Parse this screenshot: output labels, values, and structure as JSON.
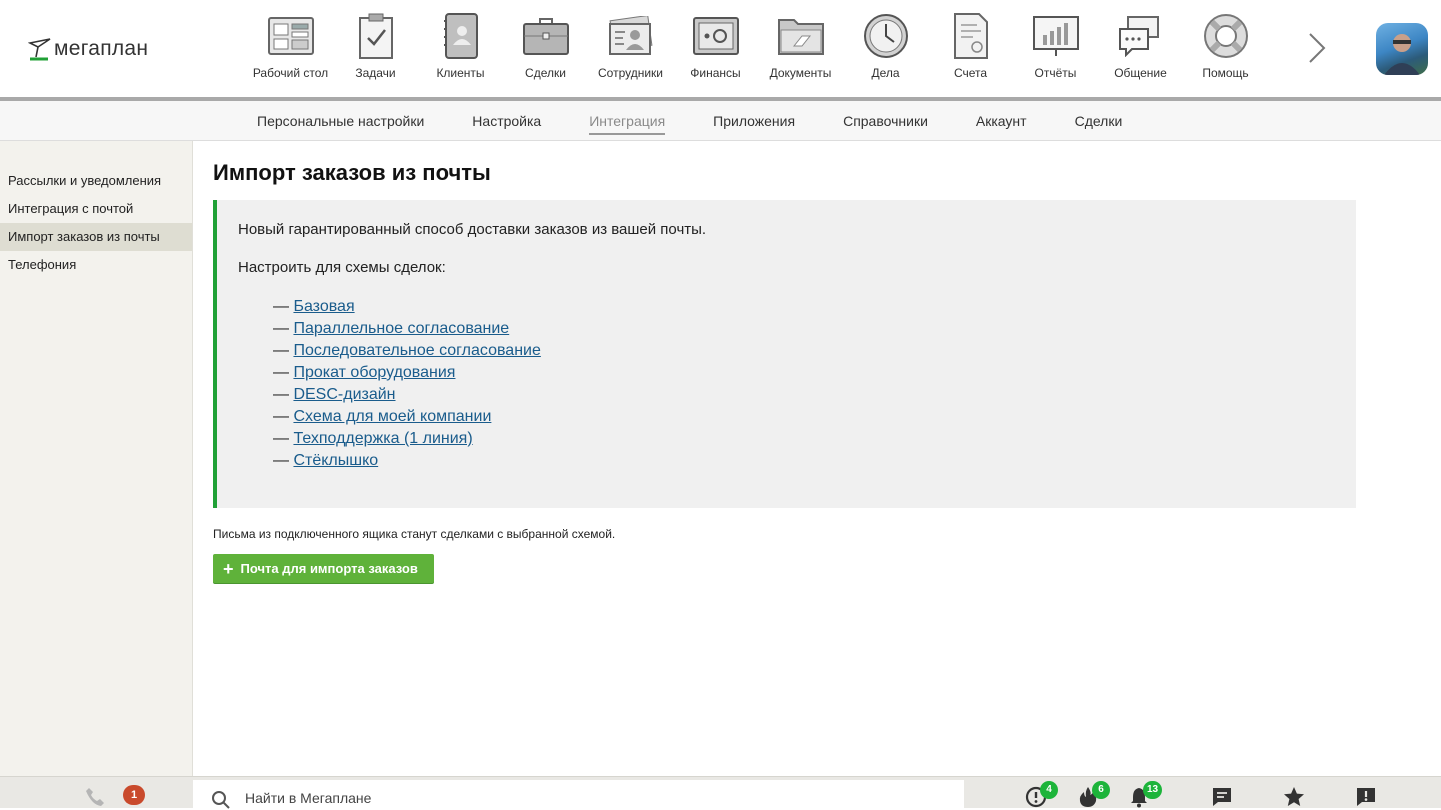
{
  "header": {
    "logo_text": "мегаплан",
    "nav": [
      {
        "label": "Рабочий стол",
        "icon": "desktop-icon"
      },
      {
        "label": "Задачи",
        "icon": "tasks-icon"
      },
      {
        "label": "Клиенты",
        "icon": "clients-icon"
      },
      {
        "label": "Сделки",
        "icon": "deals-icon"
      },
      {
        "label": "Сотрудники",
        "icon": "employees-icon"
      },
      {
        "label": "Финансы",
        "icon": "finance-icon"
      },
      {
        "label": "Документы",
        "icon": "documents-icon"
      },
      {
        "label": "Дела",
        "icon": "clock-icon"
      },
      {
        "label": "Счета",
        "icon": "invoices-icon"
      },
      {
        "label": "Отчёты",
        "icon": "reports-icon"
      },
      {
        "label": "Общение",
        "icon": "chat-icon"
      },
      {
        "label": "Помощь",
        "icon": "lifebuoy-icon"
      }
    ]
  },
  "subnav": {
    "items": [
      {
        "label": "Персональные настройки",
        "active": false
      },
      {
        "label": "Настройка",
        "active": false
      },
      {
        "label": "Интеграция",
        "active": true
      },
      {
        "label": "Приложения",
        "active": false
      },
      {
        "label": "Справочники",
        "active": false
      },
      {
        "label": "Аккаунт",
        "active": false
      },
      {
        "label": "Сделки",
        "active": false
      }
    ]
  },
  "sidebar": {
    "items": [
      {
        "label": "Рассылки и уведомления",
        "active": false
      },
      {
        "label": "Интеграция с почтой",
        "active": false
      },
      {
        "label": "Импорт заказов из почты",
        "active": true
      },
      {
        "label": "Телефония",
        "active": false
      }
    ]
  },
  "main": {
    "title": "Импорт заказов из почты",
    "intro": "Новый гарантированный способ доставки заказов из вашей почты.",
    "configure_label": "Настроить для схемы сделок:",
    "schemes": [
      "Базовая",
      "Параллельное согласование",
      "Последовательное согласование",
      "Прокат оборудования",
      "DESC-дизайн",
      "Схема для моей компании",
      "Техподдержка (1 линия)",
      "Стёклышко"
    ],
    "note": "Письма из подключенного ящика станут сделками с выбранной схемой.",
    "add_button_label": "Почта для импорта заказов"
  },
  "bottombar": {
    "phone_badge": "1",
    "search_placeholder": "Найти в Мегаплане",
    "alerts_badge": "4",
    "hot_badge": "6",
    "notifications_badge": "13"
  },
  "colors": {
    "accent_green": "#20a036",
    "button_green": "#5fb23a",
    "link_blue": "#1a5c8c",
    "badge_red": "#c94a2c",
    "badge_green": "#1db43a"
  }
}
